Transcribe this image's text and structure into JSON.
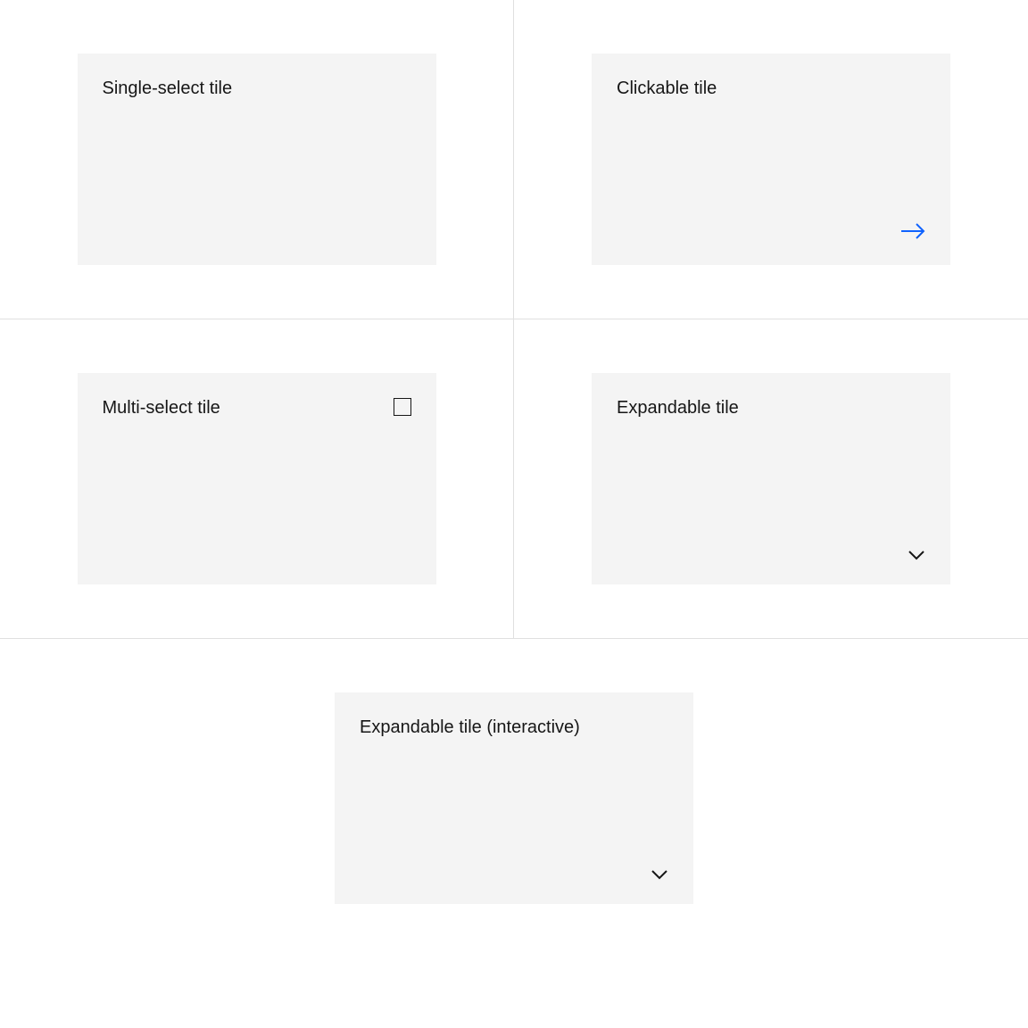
{
  "tiles": {
    "single_select": {
      "label": "Single-select tile"
    },
    "clickable": {
      "label": "Clickable tile"
    },
    "multi_select": {
      "label": "Multi-select tile"
    },
    "expandable": {
      "label": "Expandable tile"
    },
    "expandable_interactive": {
      "label": "Expandable tile (interactive)"
    }
  },
  "colors": {
    "tile_bg": "#f4f4f4",
    "accent": "#0f62fe",
    "border": "#e0e0e0",
    "text": "#161616"
  }
}
